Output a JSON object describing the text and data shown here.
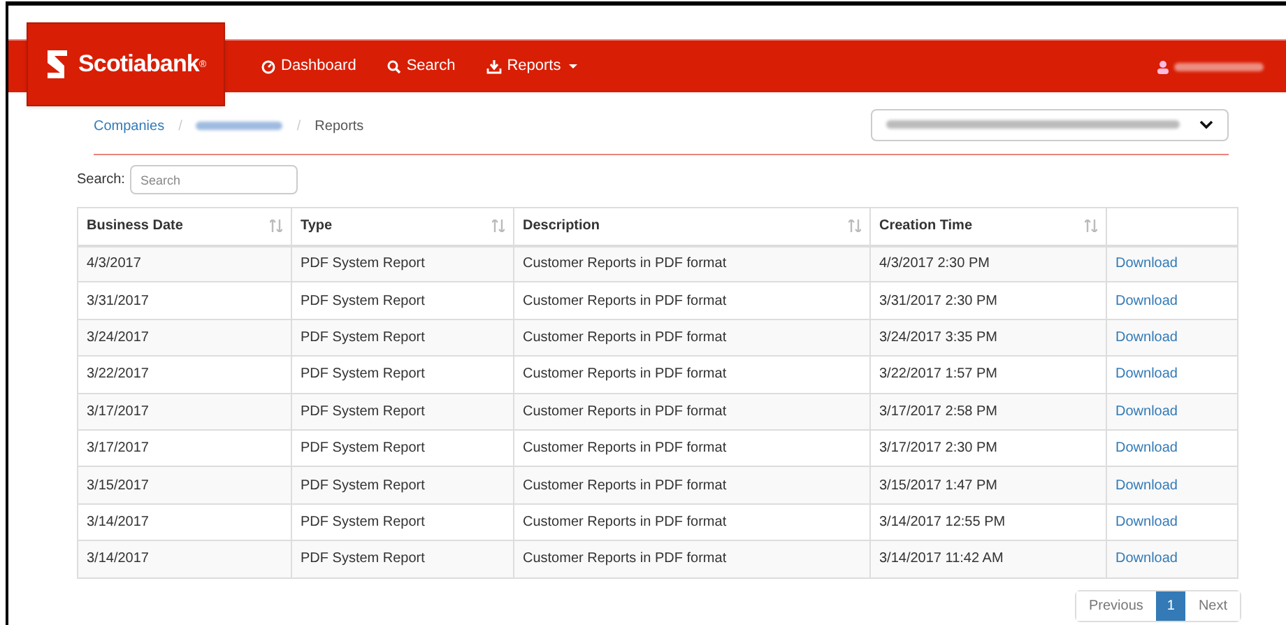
{
  "brand": {
    "name": "Scotiabank",
    "mark": "®"
  },
  "nav": [
    {
      "kind": "dashboard",
      "label": "Dashboard"
    },
    {
      "kind": "search",
      "label": "Search"
    },
    {
      "kind": "reports",
      "label": "Reports"
    }
  ],
  "breadcrumb_separators": [
    "/",
    "/"
  ],
  "breadcrumb": [
    {
      "label": "Companies",
      "kind": "link"
    },
    {
      "kind": "redacted"
    },
    {
      "label": "Reports",
      "kind": "current"
    }
  ],
  "search": {
    "label": "Search:",
    "placeholder": "Search"
  },
  "table": {
    "columns": [
      "Business Date",
      "Type",
      "Description",
      "Creation Time"
    ],
    "rows": [
      {
        "date": "4/3/2017",
        "type": "PDF System Report",
        "description": "Customer Reports in PDF format",
        "created": "4/3/2017 2:30 PM",
        "action": "Download"
      },
      {
        "date": "3/31/2017",
        "type": "PDF System Report",
        "description": "Customer Reports in PDF format",
        "created": "3/31/2017 2:30 PM",
        "action": "Download"
      },
      {
        "date": "3/24/2017",
        "type": "PDF System Report",
        "description": "Customer Reports in PDF format",
        "created": "3/24/2017 3:35 PM",
        "action": "Download"
      },
      {
        "date": "3/22/2017",
        "type": "PDF System Report",
        "description": "Customer Reports in PDF format",
        "created": "3/22/2017 1:57 PM",
        "action": "Download"
      },
      {
        "date": "3/17/2017",
        "type": "PDF System Report",
        "description": "Customer Reports in PDF format",
        "created": "3/17/2017 2:58 PM",
        "action": "Download"
      },
      {
        "date": "3/17/2017",
        "type": "PDF System Report",
        "description": "Customer Reports in PDF format",
        "created": "3/17/2017 2:30 PM",
        "action": "Download"
      },
      {
        "date": "3/15/2017",
        "type": "PDF System Report",
        "description": "Customer Reports in PDF format",
        "created": "3/15/2017 1:47 PM",
        "action": "Download"
      },
      {
        "date": "3/14/2017",
        "type": "PDF System Report",
        "description": "Customer Reports in PDF format",
        "created": "3/14/2017 12:55 PM",
        "action": "Download"
      },
      {
        "date": "3/14/2017",
        "type": "PDF System Report",
        "description": "Customer Reports in PDF format",
        "created": "3/14/2017 11:42 AM",
        "action": "Download"
      }
    ]
  },
  "pagination": {
    "previous": "Previous",
    "pages": [
      {
        "label": "1",
        "selected": true
      }
    ],
    "next": "Next"
  }
}
